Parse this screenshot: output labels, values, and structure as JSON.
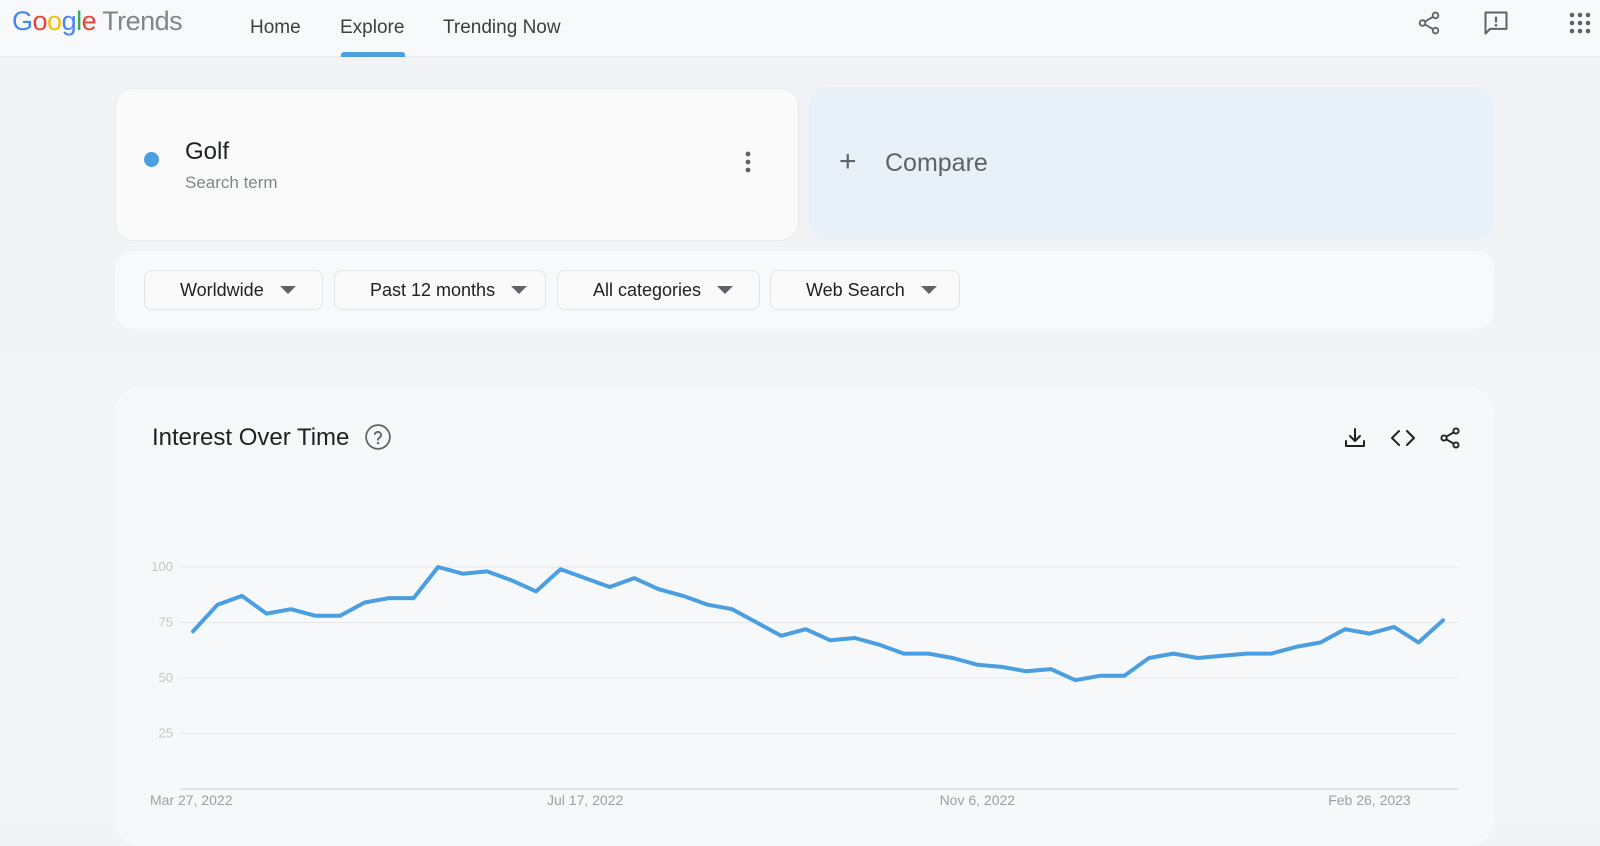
{
  "header": {
    "logo_google": [
      "G",
      "o",
      "o",
      "g",
      "l",
      "e"
    ],
    "logo_product": "Trends",
    "nav": [
      {
        "label": "Home",
        "active": false
      },
      {
        "label": "Explore",
        "active": true
      },
      {
        "label": "Trending Now",
        "active": false
      }
    ],
    "icons": [
      "share-icon",
      "feedback-icon",
      "apps-icon"
    ]
  },
  "search": {
    "term": "Golf",
    "term_type": "Search term",
    "term_color": "#4b9fe1",
    "compare_label": "Compare"
  },
  "filters": [
    {
      "label": "Worldwide"
    },
    {
      "label": "Past 12 months"
    },
    {
      "label": "All categories"
    },
    {
      "label": "Web Search"
    }
  ],
  "panel": {
    "title": "Interest Over Time",
    "actions": [
      "download-icon",
      "embed-icon",
      "share-icon"
    ]
  },
  "chart_data": {
    "type": "line",
    "title": "Interest Over Time",
    "xlabel": "",
    "ylabel": "",
    "ylim": [
      0,
      100
    ],
    "yticks": [
      25,
      50,
      75,
      100
    ],
    "x_tick_labels": [
      "Mar 27, 2022",
      "Jul 17, 2022",
      "Nov 6, 2022",
      "Feb 26, 2023"
    ],
    "x_tick_index": [
      0,
      16,
      32,
      48
    ],
    "grid": true,
    "series": [
      {
        "color": "#4b9fe1",
        "values": [
          71,
          83,
          87,
          79,
          81,
          78,
          78,
          84,
          86,
          86,
          100,
          97,
          98,
          94,
          89,
          99,
          95,
          91,
          95,
          90,
          87,
          83,
          81,
          75,
          69,
          72,
          67,
          68,
          65,
          61,
          61,
          59,
          56,
          55,
          53,
          54,
          49,
          51,
          51,
          59,
          61,
          59,
          60,
          61,
          61,
          64,
          66,
          72,
          70,
          73,
          66,
          76
        ]
      }
    ]
  }
}
